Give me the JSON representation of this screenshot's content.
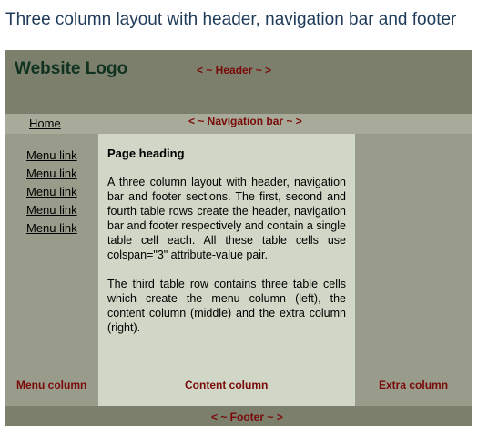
{
  "page": {
    "title": "Three column layout with header, navigation bar and footer"
  },
  "header": {
    "logo": "Website Logo",
    "label": "< ~ Header ~ >"
  },
  "nav": {
    "home_link": "Home",
    "label": "< ~ Navigation bar ~ >"
  },
  "menu_column": {
    "links": [
      "Menu link",
      "Menu link",
      "Menu link",
      "Menu link",
      "Menu link"
    ],
    "label": "Menu column"
  },
  "content_column": {
    "heading": "Page heading",
    "paragraphs": [
      "A three column layout with header, navigation bar and footer sections. The first, second and fourth table rows create the header, navigation bar and footer respectively and contain a single table cell each. All these table cells use colspan=\"3\" attribute-value pair.",
      "The third table row contains three table cells which create the menu column (left), the content column (middle) and the extra column (right)."
    ],
    "label": "Content column"
  },
  "extra_column": {
    "label": "Extra column"
  },
  "footer": {
    "label": "< ~ Footer ~ >"
  },
  "colors": {
    "header_bg": "#7b7f6c",
    "nav_bg": "#a8ab99",
    "side_column_bg": "#999c8a",
    "content_bg": "#d1d7c6",
    "label_color": "#7a0a0a",
    "logo_color": "#0f3320",
    "title_color": "#1f3b5a"
  }
}
